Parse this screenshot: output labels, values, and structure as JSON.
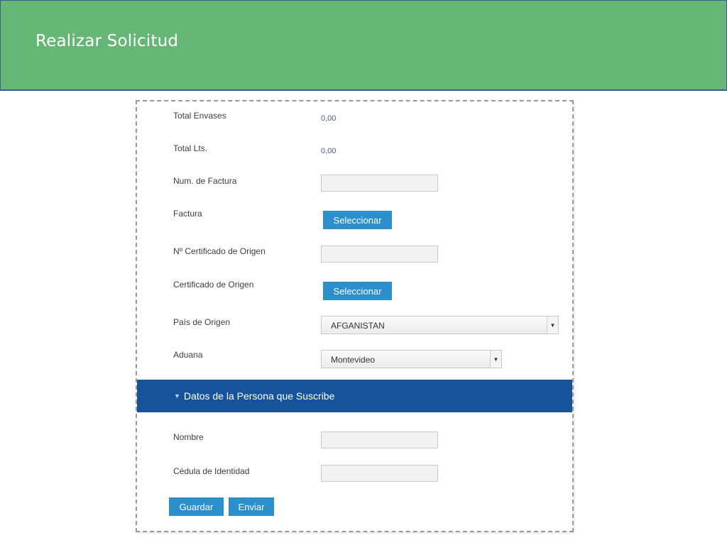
{
  "header": {
    "title": "Realizar Solicitud"
  },
  "form": {
    "total_envases": {
      "label": "Total Envases",
      "value": "0,00"
    },
    "total_lts": {
      "label": "Total Lts.",
      "value": "0,00"
    },
    "num_factura": {
      "label": "Num. de Factura",
      "value": ""
    },
    "factura": {
      "label": "Factura",
      "button_label": "Seleccionar"
    },
    "num_certificado": {
      "label": "Nº Certificado de Origen",
      "value": ""
    },
    "certificado": {
      "label": "Certificado de Origen",
      "button_label": "Seleccionar"
    },
    "pais_origen": {
      "label": "País de Origen",
      "selected": "AFGANISTAN"
    },
    "aduana": {
      "label": "Aduana",
      "selected": "Montevideo"
    }
  },
  "section": {
    "title": "Datos de la Persona que Suscribe",
    "icon": "caret-down-icon"
  },
  "person": {
    "nombre": {
      "label": "Nombre",
      "value": ""
    },
    "cedula": {
      "label": "Cédula de Identidad",
      "value": ""
    }
  },
  "actions": {
    "guardar": "Guardar",
    "enviar": "Enviar"
  },
  "colors": {
    "header_bg": "#66b676",
    "section_bg": "#17539a",
    "button_bg": "#2b8fcb"
  }
}
